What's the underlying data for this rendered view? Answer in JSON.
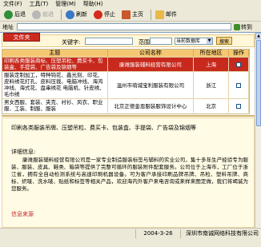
{
  "menu": [
    "文件(F)",
    "工具(T)",
    "管理(M)",
    "帮助(H)"
  ],
  "toolbar": {
    "back": "后退",
    "forward": "前进",
    "refresh": "刷新",
    "stop": "停止",
    "home": "主页",
    "mail": "邮件"
  },
  "address": {
    "label": "地址",
    "value": "",
    "go": "转到"
  },
  "search": {
    "tab": "文件夹",
    "keyword_label": "关键字:",
    "keyword_value": "",
    "range_label": "范围:",
    "range_value": "",
    "database": "当前数据库",
    "button": "搜索"
  },
  "table": {
    "headers": [
      "主题",
      "公司名称",
      "所在地区",
      "操作"
    ],
    "rows": [
      {
        "topic": "印刷各类服装商标、压塑吊粒、费买卡、包装盒、手提袋、广告袋及锦烟等",
        "company": "康潍服装辅料经营有限公司",
        "region": "上海",
        "selected": true
      },
      {
        "topic": "服装定制加工，特种钩花、鑫光刻、印花、皮料绣花打孔、皮料压裁、电脑冲线、海鸿冲线、海式花、盘串绣花 电脑机、针皮绣、毛巾绣",
        "company": "温州市萌城宝利服装有限公司",
        "region": "浙江",
        "selected": false
      },
      {
        "topic": "男女西服、套装、夹克、衬衫、风衣、职业服、工装、制服、服装",
        "company": "北京正德金恩服装服饰设计中心",
        "region": "北京",
        "selected": false
      }
    ]
  },
  "detail": {
    "summary": "印刷各类服装吊牌、压塑吊粒、费买卡、包装盒、手提袋、广告袋及锦烟等",
    "title": "详细信息:",
    "body": "康潍服装辅料经营有限公司是一家专业制造服装标签与辅料的实业公司，集十多年生产经验专为服装、服装、皮具、鞋类、箱袋等提供了完整可循环的服装附件配套服务。公司位于上海市，工厂位于浙江省，拥有全自动检测系统与高速印刷机器设备。可为客户承接印刷品牌吊牌、吊粒、塑料吊牌、商标、织唛、洗水唛、贴纸和标签等相关产品，欢迎海内外客户来电咨询或来样来图定做，我们将竭诚为您服务。",
    "source": "信息来源"
  },
  "status": {
    "date": "2004-3-26",
    "company": "深圳市南诚网络科技有限公司"
  }
}
